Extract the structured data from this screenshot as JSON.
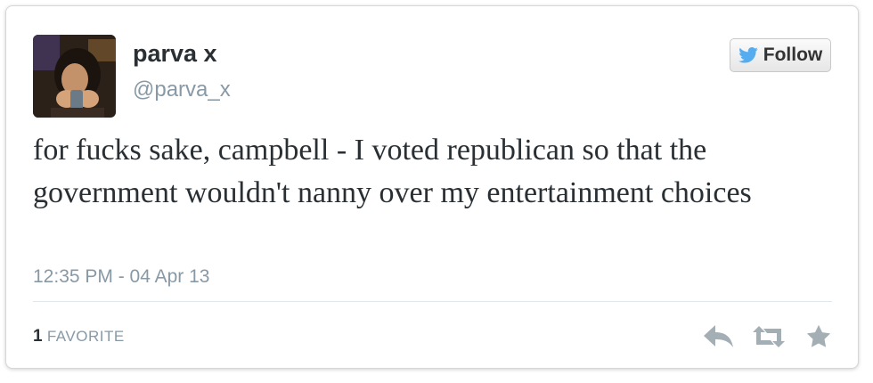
{
  "user": {
    "name": "parva x",
    "handle": "@parva_x"
  },
  "follow_button": {
    "label": "Follow",
    "icon": "twitter-bird-icon"
  },
  "tweet": {
    "text": "for fucks sake, campbell - I voted republican so that the government wouldn't nanny over my entertainment choices",
    "timestamp": "12:35 PM - 04 Apr 13"
  },
  "stats": {
    "favorites_count": "1",
    "favorites_label": "FAVORITE"
  },
  "actions": {
    "reply_icon": "reply-icon",
    "retweet_icon": "retweet-icon",
    "favorite_icon": "star-icon"
  },
  "colors": {
    "text": "#292f33",
    "muted": "#8899a6",
    "icon": "#a4aeb5"
  }
}
